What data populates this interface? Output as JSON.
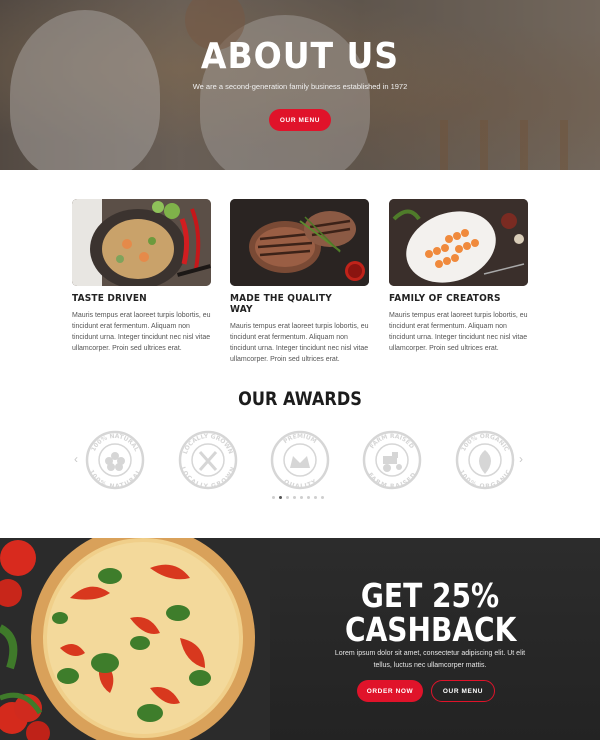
{
  "hero": {
    "title": "ABOUT US",
    "subtitle": "We are a second-generation family business established in 1972",
    "button": "OUR MENU"
  },
  "features": [
    {
      "title": "TASTE DRIVEN",
      "text": "Mauris tempus erat laoreet turpis lobortis, eu tincidunt erat fermentum. Aliquam non tincidunt urna. Integer tincidunt nec nisl vitae ullamcorper. Proin sed ultrices erat.",
      "image": "pasta-shrimp-plate"
    },
    {
      "title": "MADE THE QUALITY WAY",
      "text": "Mauris tempus erat laoreet turpis lobortis, eu tincidunt erat fermentum. Aliquam non tincidunt urna. Integer tincidunt nec nisl vitae ullamcorper. Proin sed ultrices erat.",
      "image": "grilled-steak"
    },
    {
      "title": "FAMILY OF CREATORS",
      "text": "Mauris tempus erat laoreet turpis lobortis, eu tincidunt erat fermentum. Aliquam non tincidunt urna. Integer tincidunt nec nisl vitae ullamcorper. Proin sed ultrices erat.",
      "image": "shrimp-skewers-platter"
    }
  ],
  "awards": {
    "title": "OUR AWARDS",
    "badges": [
      {
        "top": "100% NATURAL",
        "bottom": "100% NATURAL",
        "icon": "flower-icon"
      },
      {
        "top": "LOCALLY GROWN",
        "bottom": "LOCALLY GROWN",
        "icon": "garden-tools-icon"
      },
      {
        "top": "PREMIUM",
        "bottom": "QUALITY",
        "icon": "crown-icon"
      },
      {
        "top": "FARM RAISED",
        "bottom": "FARM RAISED",
        "icon": "tractor-icon"
      },
      {
        "top": "100% ORGANIC",
        "bottom": "100% ORGANIC",
        "icon": "leaf-icon"
      }
    ],
    "pagination_count": 8,
    "active_page": 2
  },
  "promo": {
    "title_line1": "GET 25%",
    "title_line2": "CASHBACK",
    "text": "Lorem ipsum dolor sit amet, consectetur adipiscing elit. Ut elit tellus, luctus nec ullamcorper mattis.",
    "primary_button": "ORDER NOW",
    "secondary_button": "OUR MENU"
  },
  "colors": {
    "accent": "#e0132a",
    "dark_section": "#2a2a2a",
    "badge_gray": "#d6d6d6"
  }
}
